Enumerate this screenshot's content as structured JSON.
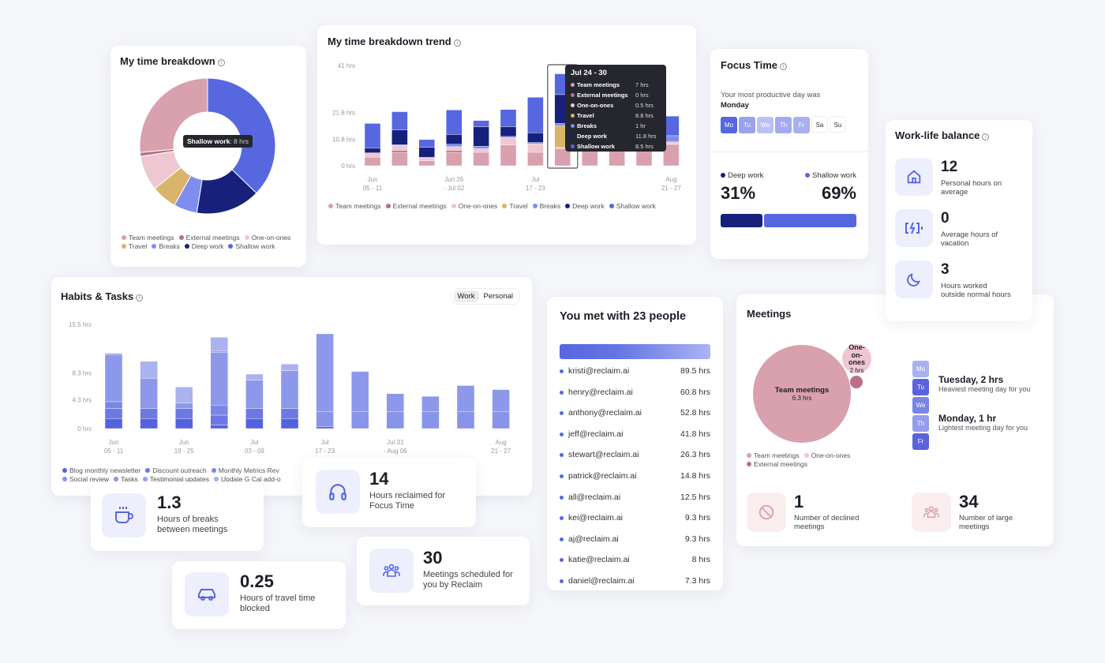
{
  "colors": {
    "team": "#d9a0ae",
    "external": "#b87086",
    "oneonones": "#eec7d2",
    "travel": "#d8b56a",
    "breaks": "#7f8df0",
    "deep": "#17217c",
    "shallow": "#5667e0",
    "accent": "#5667e0"
  },
  "breakdown": {
    "title": "My time breakdown",
    "tooltip_label": "Shallow work",
    "tooltip_value": ": 8 hrs"
  },
  "trend": {
    "title": "My time breakdown trend",
    "tooltip": {
      "title": "Jul 24 - 30",
      "rows": [
        {
          "label": "Team meetings",
          "value": "7 hrs"
        },
        {
          "label": "External meetings",
          "value": "0 hrs"
        },
        {
          "label": "One-on-ones",
          "value": "0.5 hrs"
        },
        {
          "label": "Travel",
          "value": "8.8 hrs"
        },
        {
          "label": "Breaks",
          "value": "1 hr"
        },
        {
          "label": "Deep work",
          "value": "11.8 hrs"
        },
        {
          "label": "Shallow work",
          "value": "8.5 hrs"
        }
      ]
    }
  },
  "habits": {
    "title": "Habits & Tasks",
    "toggle": {
      "work": "Work",
      "personal": "Personal",
      "selected": "Work"
    }
  },
  "chart_data": [
    {
      "type": "pie",
      "title": "My time breakdown",
      "donut": true,
      "labels": [
        "Shallow work",
        "Deep work",
        "Breaks",
        "Travel",
        "One-on-ones",
        "External meetings",
        "Team meetings"
      ],
      "values": [
        8,
        3.3,
        1.2,
        1.3,
        1.8,
        0.2,
        5.7
      ],
      "legend": [
        "Team meetings",
        "External meetings",
        "One-on-ones",
        "Travel",
        "Breaks",
        "Deep work",
        "Shallow work"
      ],
      "legend_position": "bottom"
    },
    {
      "type": "bar",
      "stacked": true,
      "title": "My time breakdown trend",
      "categories": [
        "Jun 05 - 11",
        "Jun 12 - 18",
        "Jun 19 - 25",
        "Jun 26 - Jul 02",
        "Jul 03 - 09",
        "Jul 10 - 16",
        "Jul 17 - 23",
        "Jul 24 - 30",
        "Jul 31 - Aug 06",
        "Aug 07 - 13",
        "Aug 14 - 20",
        "Aug 21 - 27"
      ],
      "tick_labels": [
        [
          "Jun",
          "05 - 11"
        ],
        null,
        null,
        [
          "Jun 26",
          "- Jul 02"
        ],
        null,
        null,
        [
          "Jul",
          "17 - 23"
        ],
        null,
        null,
        null,
        null,
        [
          "Aug",
          "21 - 27"
        ]
      ],
      "yticks": [
        {
          "v": 0,
          "label": "0 hrs"
        },
        {
          "v": 10.8,
          "label": "10.8 hrs"
        },
        {
          "v": 21.8,
          "label": "21.8 hrs"
        },
        {
          "v": 41,
          "label": "41 hrs"
        }
      ],
      "ylim": [
        0,
        41
      ],
      "highlight": 7,
      "series": [
        {
          "name": "Team meetings",
          "key": "team",
          "values": [
            3.5,
            5.5,
            2,
            5.5,
            5.5,
            8.5,
            5.5,
            7,
            8,
            8,
            8,
            8.5
          ]
        },
        {
          "name": "External meetings",
          "key": "external",
          "values": [
            0,
            0.8,
            0,
            0.8,
            0,
            0,
            0,
            0,
            0,
            0,
            0,
            0.3
          ]
        },
        {
          "name": "One-on-ones",
          "key": "oneonones",
          "values": [
            1.5,
            2,
            1.2,
            1.5,
            1.5,
            3,
            3.5,
            0.5,
            1,
            1,
            1,
            1
          ]
        },
        {
          "name": "Travel",
          "key": "travel",
          "values": [
            0,
            0,
            0,
            0,
            0,
            0,
            0,
            8.8,
            0,
            0,
            0,
            0
          ]
        },
        {
          "name": "Breaks",
          "key": "breaks",
          "values": [
            0.3,
            0.3,
            0.3,
            1,
            1,
            0.5,
            0.5,
            1,
            1,
            1,
            1,
            2.5
          ]
        },
        {
          "name": "Deep work",
          "key": "deep",
          "values": [
            2,
            6,
            4,
            4,
            8,
            4,
            4,
            11.8,
            4,
            4,
            4,
            0
          ]
        },
        {
          "name": "Shallow work",
          "key": "shallow",
          "values": [
            10,
            7.5,
            3.2,
            10,
            2.5,
            7,
            14.5,
            8.5,
            8,
            8,
            8,
            8
          ]
        }
      ],
      "legend_position": "bottom"
    },
    {
      "type": "bar",
      "stacked": true,
      "title": "Habits & Tasks",
      "categories": [
        "Jun 05 - 11",
        "Jun 12 - 18",
        "Jun 19 - 25",
        "Jun 26 - Jul 02",
        "Jul 03 - 09",
        "Jul 10 - 16",
        "Jul 17 - 23",
        "Jul 24 - 30",
        "Jul 31 - Aug 06",
        "Aug 07 - 13",
        "Aug 14 - 20",
        "Aug 21 - 27"
      ],
      "tick_labels": [
        [
          "Jun",
          "05 - 11"
        ],
        null,
        [
          "Jun",
          "19 - 25"
        ],
        null,
        [
          "Jul",
          "03 - 09"
        ],
        null,
        [
          "Jul",
          "17 - 23"
        ],
        null,
        [
          "Jul 31",
          "- Aug 06"
        ],
        null,
        null,
        [
          "Aug",
          "21 - 27"
        ]
      ],
      "yticks": [
        {
          "v": 0,
          "label": "0 hrs"
        },
        {
          "v": 4.3,
          "label": "4.3 hrs"
        },
        {
          "v": 8.3,
          "label": "8.3 hrs"
        },
        {
          "v": 15.5,
          "label": "15.5 hrs"
        }
      ],
      "ylim": [
        0,
        15.5
      ],
      "series": [
        {
          "name": "Blog monthly newsletter",
          "color": "#5562df",
          "values": [
            1.5,
            1.5,
            1.5,
            0.5,
            1.5,
            1.5,
            0.3,
            0,
            0,
            0,
            0,
            0
          ]
        },
        {
          "name": "Discount outreach",
          "color": "#6c78e4",
          "values": [
            1.5,
            1.5,
            1.5,
            1.5,
            1.5,
            1.5,
            0,
            0,
            0,
            0,
            0,
            0
          ]
        },
        {
          "name": "Monthly Metrics Rev",
          "color": "#7a85e7",
          "values": [
            1,
            0,
            0,
            1.5,
            0,
            0,
            0,
            0,
            0,
            0,
            0,
            0
          ]
        },
        {
          "name": "Social review",
          "color": "#8894ea",
          "values": [
            0,
            0,
            0,
            0,
            0,
            0,
            2.2,
            2.5,
            2.5,
            2.5,
            2.5,
            2.5
          ]
        },
        {
          "name": "Tasks",
          "color": "#8e98ea",
          "values": [
            7,
            4.5,
            0.8,
            7.8,
            4.2,
            5.6,
            11.6,
            6,
            2.7,
            2.3,
            3.9,
            3.3
          ]
        },
        {
          "name": "Testimonial updates",
          "color": "#98a1ec",
          "values": [
            0.2,
            0,
            0,
            0.3,
            0,
            0,
            0,
            0,
            0,
            0,
            0,
            0
          ]
        },
        {
          "name": "Update G Cal add-o",
          "color": "#abb2f0",
          "values": [
            0,
            2.5,
            2.4,
            2,
            0.9,
            1,
            0,
            0,
            0,
            0,
            0,
            0
          ]
        }
      ],
      "legend_position": "bottom"
    }
  ],
  "focus": {
    "title": "Focus Time",
    "line1": "Your most productive day was",
    "day": "Monday",
    "days": [
      {
        "d": "Mo",
        "c": "#5667e0"
      },
      {
        "d": "Tu",
        "c": "#9aa2ee"
      },
      {
        "d": "We",
        "c": "#bcc1f4"
      },
      {
        "d": "Th",
        "c": "#a3aaf0"
      },
      {
        "d": "Fr",
        "c": "#a9b0f0"
      },
      {
        "d": "Sa",
        "c": "#ffffff"
      },
      {
        "d": "Su",
        "c": "#ffffff"
      }
    ],
    "deep_label": "Deep work",
    "deep_pct": "31%",
    "shallow_label": "Shallow work",
    "shallow_pct": "69%",
    "deep_fraction": 0.31
  },
  "worklife": {
    "title": "Work-life balance",
    "items": [
      {
        "icon": "home-icon",
        "value": "12",
        "label": "Personal hours on average"
      },
      {
        "icon": "battery-charging-icon",
        "value": "0",
        "label": "Average hours of vacation"
      },
      {
        "icon": "moon-icon",
        "value": "3",
        "label": "Hours worked outside normal hours"
      }
    ]
  },
  "people": {
    "title": "You met with 23 people",
    "list": [
      {
        "email": "kristi@reclaim.ai",
        "hrs": "89.5 hrs"
      },
      {
        "email": "henry@reclaim.ai",
        "hrs": "60.8 hrs"
      },
      {
        "email": "anthony@reclaim.ai",
        "hrs": "52.8 hrs"
      },
      {
        "email": "jeff@reclaim.ai",
        "hrs": "41.8 hrs"
      },
      {
        "email": "stewart@reclaim.ai",
        "hrs": "26.3 hrs"
      },
      {
        "email": "patrick@reclaim.ai",
        "hrs": "14.8 hrs"
      },
      {
        "email": "all@reclaim.ai",
        "hrs": "12.5 hrs"
      },
      {
        "email": "kei@reclaim.ai",
        "hrs": "9.3 hrs"
      },
      {
        "email": "aj@reclaim.ai",
        "hrs": "9.3 hrs"
      },
      {
        "email": "katie@reclaim.ai",
        "hrs": "8 hrs"
      },
      {
        "email": "daniel@reclaim.ai",
        "hrs": "7.3 hrs"
      }
    ]
  },
  "meetings": {
    "title": "Meetings",
    "bubbles": [
      {
        "label": "Team meetings",
        "value": "6.3 hrs"
      },
      {
        "label": "One-on-ones",
        "label_lines": [
          "One-",
          "on-",
          "ones"
        ],
        "value": "2 hrs"
      },
      {
        "label": "External meetings"
      }
    ],
    "legend": [
      "Team meetings",
      "One-on-ones",
      "External meetings"
    ],
    "weekdays": [
      {
        "d": "Mo",
        "c": "#a9b0f0"
      },
      {
        "d": "Tu",
        "c": "#5a63dc"
      },
      {
        "d": "We",
        "c": "#7a83e6"
      },
      {
        "d": "Th",
        "c": "#959ceb"
      },
      {
        "d": "Fr",
        "c": "#5a63dc"
      }
    ],
    "heaviest_title": "Tuesday, 2 hrs",
    "heaviest_sub": "Heaviest meeting day for you",
    "lightest_title": "Monday, 1 hr",
    "lightest_sub": "Lightest meeting day for you",
    "declined_value": "1",
    "declined_label": "Number of declined meetings",
    "large_value": "34",
    "large_label": "Number of large meetings"
  },
  "stats": {
    "breaks": {
      "value": "1.3",
      "label": "Hours of breaks between meetings"
    },
    "focus": {
      "value": "14",
      "label": "Hours reclaimed for Focus Time"
    },
    "travel": {
      "value": "0.25",
      "label": "Hours of travel time blocked"
    },
    "scheduled": {
      "value": "30",
      "label": "Meetings scheduled for you by Reclaim"
    }
  }
}
